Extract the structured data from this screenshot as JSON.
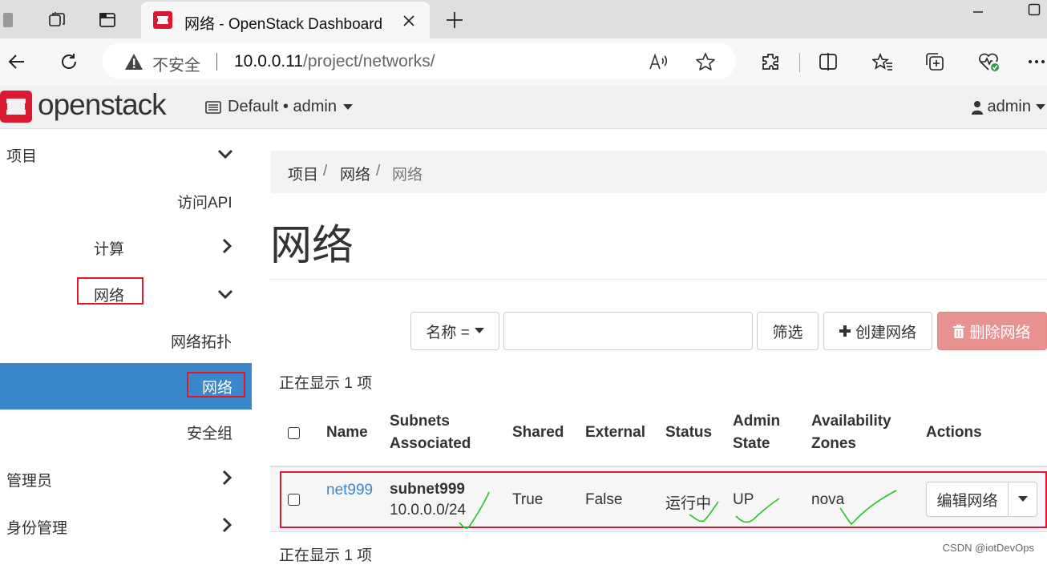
{
  "browser": {
    "tab_title": "网络 - OpenStack Dashboard",
    "insecure_label": "不安全",
    "url_host": "10.0.0.11",
    "url_path": "/project/networks/",
    "icons": [
      "workspaces-icon",
      "tab-actions-icon",
      "new-tab-icon",
      "back-icon",
      "refresh-icon",
      "warning-icon",
      "read-aloud-icon",
      "favorite-icon",
      "extensions-icon",
      "split-screen-icon",
      "favorites-icon",
      "collections-icon",
      "browser-essentials-icon",
      "more-icon"
    ]
  },
  "header": {
    "logo_text": "openstack",
    "project_switcher": "Default • admin",
    "user": "admin"
  },
  "sidebar": {
    "project": "项目",
    "api_access": "访问API",
    "compute": "计算",
    "network": "网络",
    "network_topology": "网络拓扑",
    "networks": "网络",
    "security_groups": "安全组",
    "admin": "管理员",
    "identity": "身份管理"
  },
  "breadcrumb": [
    "项目",
    "网络",
    "网络"
  ],
  "page_title": "网络",
  "toolbar": {
    "filter_field": "名称 =",
    "filter_value": "",
    "filter_button": "筛选",
    "create_button": "创建网络",
    "delete_button": "删除网络"
  },
  "count_top": "正在显示 1 项",
  "count_bottom": "正在显示 1 项",
  "table": {
    "headers": {
      "name": "Name",
      "subnets_1": "Subnets",
      "subnets_2": "Associated",
      "shared": "Shared",
      "external": "External",
      "status": "Status",
      "admin_1": "Admin",
      "admin_2": "State",
      "az_1": "Availability",
      "az_2": "Zones",
      "actions": "Actions"
    },
    "rows": [
      {
        "name": "net999",
        "subnet_name": "subnet999",
        "subnet_cidr": "10.0.0.0/24",
        "shared": "True",
        "external": "False",
        "status": "运行中",
        "admin_state": "UP",
        "availability_zones": "nova",
        "action": "编辑网络"
      }
    ]
  },
  "watermark": "CSDN @iotDevOps",
  "colors": {
    "accent_blue": "#3b87cc",
    "openstack_red": "#da1a32",
    "danger_button": "#e79291",
    "annotation_red": "#e0182b",
    "annotation_green": "#22c622"
  }
}
